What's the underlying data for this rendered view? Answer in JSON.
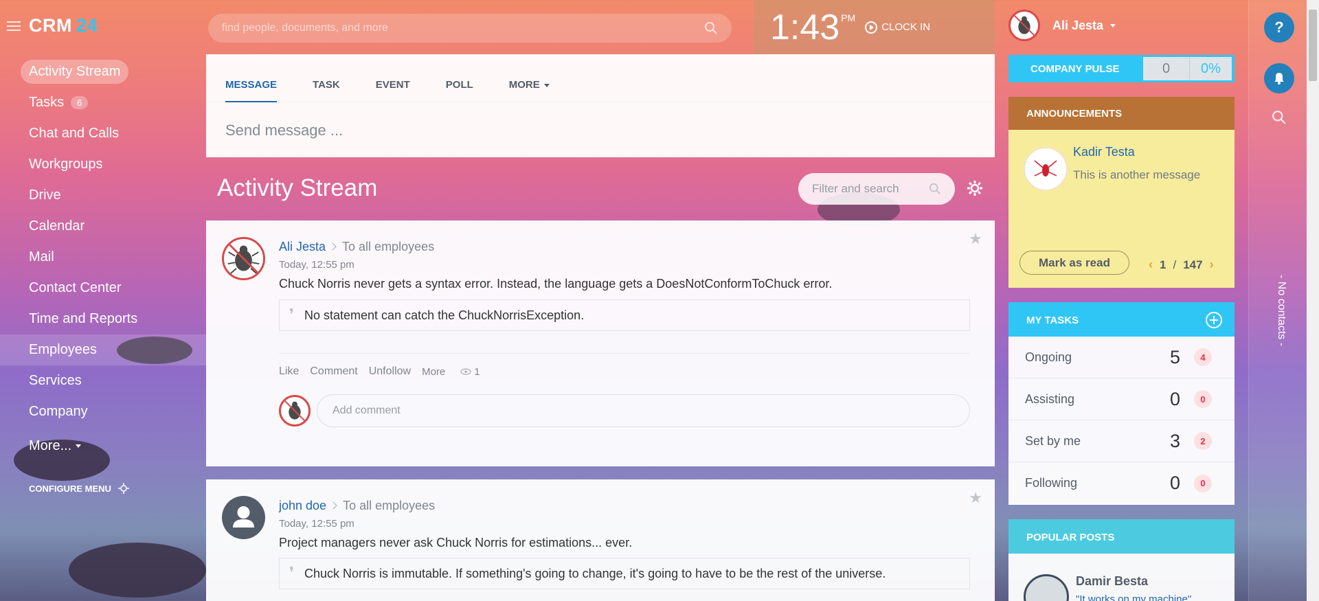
{
  "app": {
    "logo_main": "CRM",
    "logo_accent": "24",
    "brand_color": "#2fc6f6"
  },
  "search": {
    "placeholder": "find people, documents, and more"
  },
  "clock": {
    "time": "1:43",
    "ampm": "PM",
    "clock_in": "CLOCK IN"
  },
  "sidebar": {
    "items": [
      {
        "label": "Activity Stream"
      },
      {
        "label": "Tasks",
        "counter": "6"
      },
      {
        "label": "Chat and Calls"
      },
      {
        "label": "Workgroups"
      },
      {
        "label": "Drive"
      },
      {
        "label": "Calendar"
      },
      {
        "label": "Mail"
      },
      {
        "label": "Contact Center"
      },
      {
        "label": "Time and Reports"
      },
      {
        "label": "Employees"
      },
      {
        "label": "Services"
      },
      {
        "label": "Company"
      },
      {
        "label": "More..."
      }
    ],
    "configure": "CONFIGURE MENU"
  },
  "composer": {
    "tabs": [
      "MESSAGE",
      "TASK",
      "EVENT",
      "POLL",
      "MORE"
    ],
    "placeholder": "Send message ..."
  },
  "stream": {
    "title": "Activity Stream",
    "filter_placeholder": "Filter and search"
  },
  "posts": [
    {
      "author": "Ali Jesta",
      "destination": "To all employees",
      "time": "Today, 12:55 pm",
      "text": "Chuck Norris never gets a syntax error. Instead, the language gets a DoesNotConformToChuck error.",
      "quote": "No statement can catch the ChuckNorrisException.",
      "actions": [
        "Like",
        "Comment",
        "Unfollow",
        "More"
      ],
      "views": "1",
      "comment_placeholder": "Add comment"
    },
    {
      "author": "john doe",
      "destination": "To all employees",
      "time": "Today, 12:55 pm",
      "text": "Project managers never ask Chuck Norris for estimations... ever.",
      "quote": "Chuck Norris is immutable. If something's going to change, it's going to have to be the rest of the universe."
    }
  ],
  "profile": {
    "name": "Ali Jesta"
  },
  "pulse": {
    "label": "COMPANY PULSE",
    "value": "0",
    "percent": "0%"
  },
  "announcements": {
    "title": "ANNOUNCEMENTS",
    "author": "Kadir Testa",
    "message": "This is another message",
    "mark_read": "Mark as read",
    "page": "1",
    "sep": "/",
    "total": "147"
  },
  "tasks": {
    "title": "MY TASKS",
    "rows": [
      {
        "label": "Ongoing",
        "count": "5",
        "badge": "4"
      },
      {
        "label": "Assisting",
        "count": "0",
        "badge": "0"
      },
      {
        "label": "Set by me",
        "count": "3",
        "badge": "2"
      },
      {
        "label": "Following",
        "count": "0",
        "badge": "0"
      }
    ]
  },
  "popular": {
    "title": "POPULAR POSTS",
    "name": "Damir Besta",
    "quote": "\"It works on my machine\""
  },
  "rail": {
    "help": "?",
    "no_contacts": "- No contacts -"
  }
}
